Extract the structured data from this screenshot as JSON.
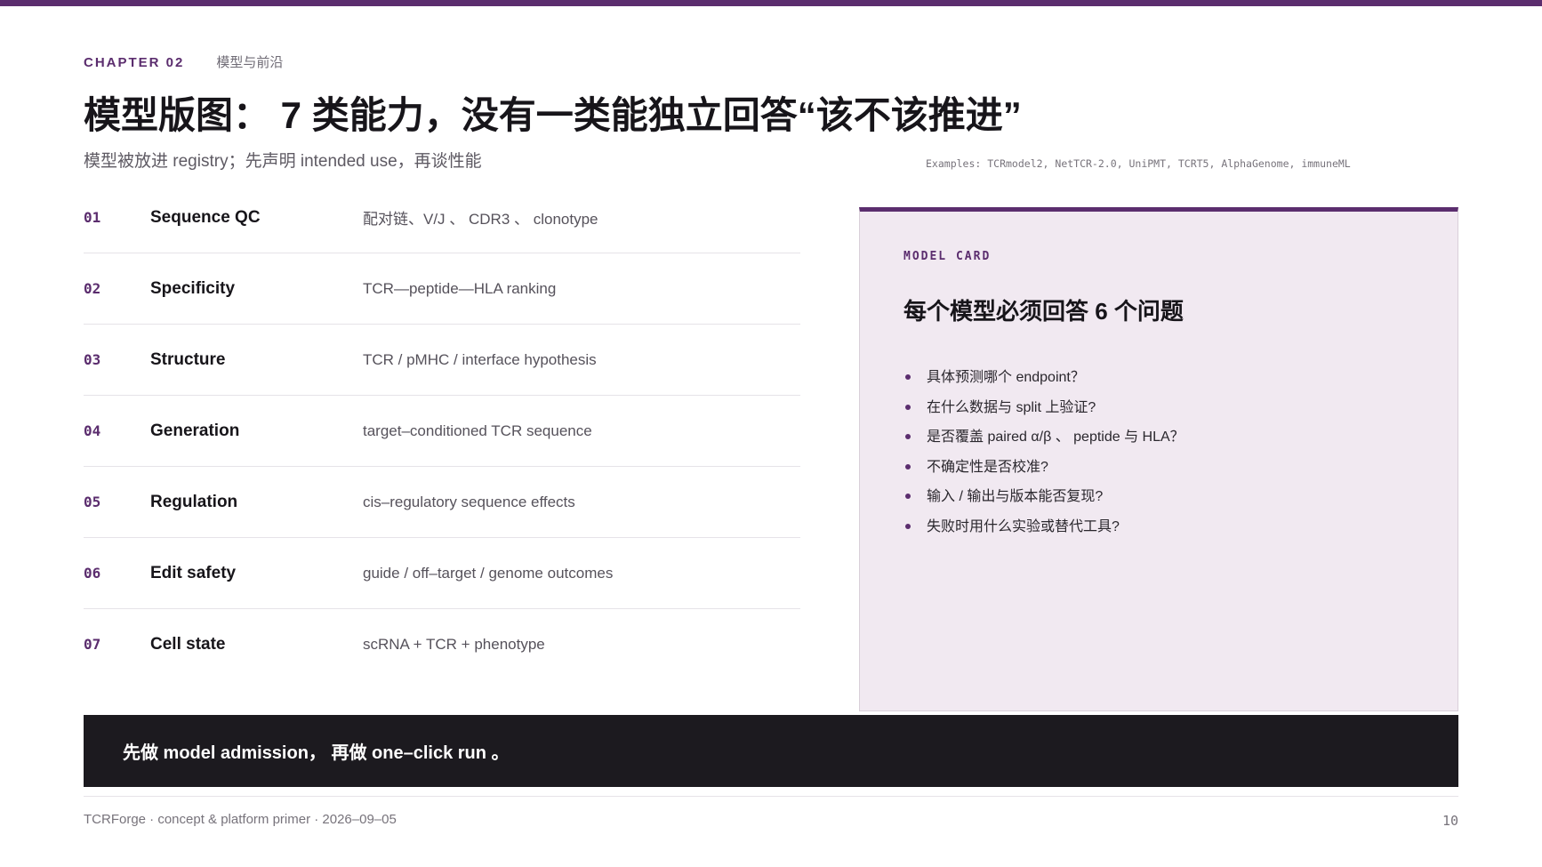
{
  "header": {
    "chapter_label": "CHAPTER 02",
    "chapter_subtitle": "模型与前沿",
    "title": "模型版图： 7 类能力，没有一类能独立回答“该不该推进”",
    "subtitle": "模型被放进 registry；先声明 intended use，再谈性能",
    "examples": "Examples: TCRmodel2, NetTCR-2.0, UniPMT, TCRT5, AlphaGenome, immuneML"
  },
  "capabilities": [
    {
      "num": "01",
      "name": "Sequence QC",
      "desc": "配对链、V/J 、 CDR3 、 clonotype"
    },
    {
      "num": "02",
      "name": "Specificity",
      "desc": "TCR—peptide—HLA ranking"
    },
    {
      "num": "03",
      "name": "Structure",
      "desc": "TCR / pMHC / interface hypothesis"
    },
    {
      "num": "04",
      "name": "Generation",
      "desc": "target–conditioned TCR sequence"
    },
    {
      "num": "05",
      "name": "Regulation",
      "desc": "cis–regulatory sequence effects"
    },
    {
      "num": "06",
      "name": "Edit safety",
      "desc": "guide / off–target / genome outcomes"
    },
    {
      "num": "07",
      "name": "Cell state",
      "desc": "scRNA + TCR + phenotype"
    }
  ],
  "model_card": {
    "label": "MODEL CARD",
    "title": "每个模型必须回答 6 个问题",
    "questions": [
      "具体预测哪个 endpoint？",
      "在什么数据与 split 上验证?",
      "是否覆盖 paired α/β 、 peptide 与 HLA？",
      "不确定性是否校准?",
      "输入 / 输出与版本能否复现?",
      "失败时用什么实验或替代工具?"
    ]
  },
  "banner": {
    "text": "先做 model admission， 再做 one–click run 。"
  },
  "footer": {
    "left": "TCRForge · concept & platform primer · 2026–09–05",
    "page": "10"
  },
  "colors": {
    "accent": "#5b2d6e",
    "card_bg": "#f1e9f1",
    "banner_bg": "#1c1a1f"
  }
}
